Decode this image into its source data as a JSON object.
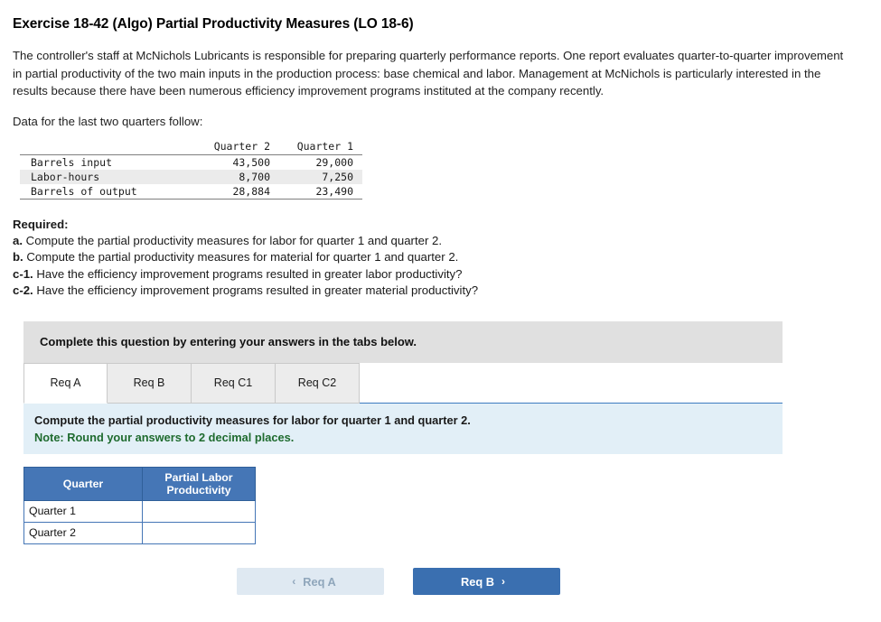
{
  "title": "Exercise 18-42 (Algo) Partial Productivity Measures (LO 18-6)",
  "intro": "The controller's staff at McNichols Lubricants is responsible for preparing quarterly performance reports. One report evaluates quarter-to-quarter improvement in partial productivity of the two main inputs in the production process: base chemical and labor. Management at McNichols is particularly interested in the results because there have been numerous efficiency improvement programs instituted at the company recently.",
  "data_lead": "Data for the last two quarters follow:",
  "data_table": {
    "headers": [
      "",
      "Quarter 2",
      "Quarter 1"
    ],
    "rows": [
      {
        "label": "Barrels input",
        "q2": "43,500",
        "q1": "29,000"
      },
      {
        "label": "Labor-hours",
        "q2": "8,700",
        "q1": "7,250"
      },
      {
        "label": "Barrels of output",
        "q2": "28,884",
        "q1": "23,490"
      }
    ]
  },
  "required": {
    "heading": "Required:",
    "items": [
      {
        "marker": "a.",
        "text": "Compute the partial productivity measures for labor for quarter 1 and quarter 2."
      },
      {
        "marker": "b.",
        "text": "Compute the partial productivity measures for material for quarter 1 and quarter 2."
      },
      {
        "marker": "c-1.",
        "text": "Have the efficiency improvement programs resulted in greater labor productivity?"
      },
      {
        "marker": "c-2.",
        "text": "Have the efficiency improvement programs resulted in greater material productivity?"
      }
    ]
  },
  "instruction_bar": "Complete this question by entering your answers in the tabs below.",
  "tabs": [
    {
      "label": "Req A",
      "active": true
    },
    {
      "label": "Req B",
      "active": false
    },
    {
      "label": "Req C1",
      "active": false
    },
    {
      "label": "Req C2",
      "active": false
    }
  ],
  "question_panel": {
    "prompt": "Compute the partial productivity measures for labor for quarter 1 and quarter 2.",
    "note": "Note: Round your answers to 2 decimal places."
  },
  "answer_table": {
    "headers": [
      "Quarter",
      "Partial Labor Productivity"
    ],
    "header_line1": "Partial Labor",
    "header_line2": "Productivity",
    "rows": [
      {
        "quarter": "Quarter 1",
        "value": ""
      },
      {
        "quarter": "Quarter 2",
        "value": ""
      }
    ]
  },
  "nav": {
    "prev_label": "Req A",
    "prev_chevron": "‹",
    "next_label": "Req B",
    "next_chevron": "›"
  },
  "colors": {
    "accent_blue": "#4576b6",
    "panel_blue": "#e2eff7",
    "bar_grey": "#e0e0e0",
    "note_green": "#1f6b2f"
  }
}
